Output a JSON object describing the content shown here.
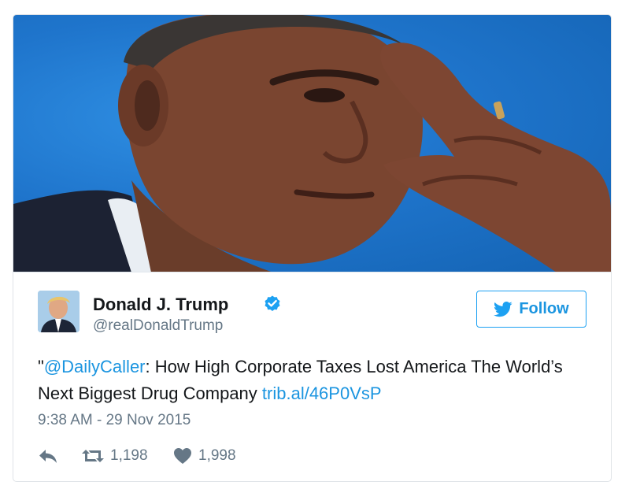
{
  "tweet": {
    "author": {
      "name": "Donald J. Trump",
      "handle": "@realDonaldTrump",
      "verified": true
    },
    "follow_label": "Follow",
    "text": {
      "open_quote": "\"",
      "mention": "@DailyCaller",
      "body": ": How High Corporate Taxes Lost America The World’s Next Biggest Drug Company ",
      "link": "trib.al/46P0VsP"
    },
    "timestamp": "9:38 AM - 29 Nov 2015",
    "retweets": "1,198",
    "likes": "1,998"
  },
  "icons": {
    "verified": "verified-badge-icon",
    "follow": "twitter-bird-icon",
    "reply": "reply-icon",
    "retweet": "retweet-icon",
    "like": "heart-icon"
  },
  "colors": {
    "accent": "#1da1f2",
    "link": "#1b95e0",
    "secondary_text": "#657786",
    "photo_background": "#1f75cc"
  }
}
